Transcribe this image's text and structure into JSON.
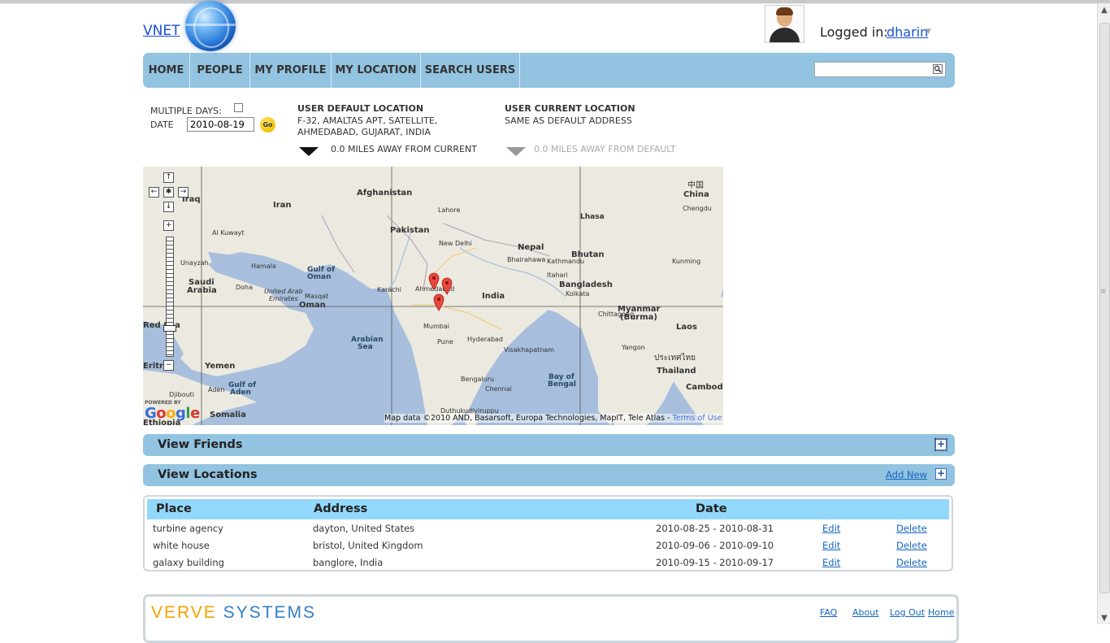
{
  "header": {
    "brand": "VNET",
    "login_label": "Logged in:",
    "username": "dharin"
  },
  "nav": {
    "items": [
      "HOME",
      "PEOPLE",
      "MY PROFILE",
      "MY LOCATION",
      "SEARCH USERS"
    ],
    "search_value": ""
  },
  "filters": {
    "multiple_days_label": "MULTIPLE DAYS:",
    "date_label": "DATE",
    "date_value": "2010-08-19",
    "go_label": "Go",
    "default_location_title": "USER DEFAULT LOCATION",
    "default_location_line1": "F-32, AMALTAS APT, SATELLITE,",
    "default_location_line2": "AHMEDABAD, GUJARAT, INDIA",
    "current_location_title": "USER CURRENT LOCATION",
    "current_location_text": "SAME AS DEFAULT ADDRESS",
    "distance_from_current": "0.0 MILES AWAY FROM CURRENT",
    "distance_from_default": "0.0 MILES AWAY FROM DEFAULT"
  },
  "map": {
    "labels": {
      "iran": "Iran",
      "afghanistan": "Afghanistan",
      "pakistan": "Pakistan",
      "china_cn": "中国",
      "china": "China",
      "india": "India",
      "nepal": "Nepal",
      "bhutan": "Bhutan",
      "bangladesh": "Bangladesh",
      "myanmar": "Myanmar",
      "burma": "(Burma)",
      "laos": "Laos",
      "thailand": "Thailand",
      "thailand_th": "ประเทศไทย",
      "cambodia": "Cambodia",
      "yemen": "Yemen",
      "oman": "Oman",
      "saudi_arabia_1": "Saudi",
      "saudi_arabia_2": "Arabia",
      "uae_1": "United Arab",
      "uae_2": "Emirates",
      "somalia": "Somalia",
      "djibouti": "Djibouti",
      "ethiopia": "Ethiopia",
      "arabian_sea_1": "Arabian",
      "arabian_sea_2": "Sea",
      "bay_bengal_1": "Bay of",
      "bay_bengal_2": "Bengal",
      "gulf_oman_1": "Gulf of",
      "gulf_oman_2": "Oman",
      "gulf_aden_1": "Gulf of",
      "gulf_aden_2": "Aden",
      "new_delhi": "New Delhi",
      "lahore": "Lahore",
      "karachi": "Karachi",
      "mumbai": "Mumbai",
      "pune": "Pune",
      "hyderabad": "Hyderabad",
      "bengaluru": "Bengaluru",
      "chennai": "Chennai",
      "kolkata": "Kolkata",
      "chittagong": "Chittagong",
      "kathmandu": "Kathmandu",
      "lhasa": "Lhasa",
      "chengdu": "Chengdu",
      "kunming": "Kunming",
      "yangon": "Yangon",
      "visakhapatnam": "Visakhapatnam",
      "muscat": "Masqat",
      "doha": "Doha",
      "ahmedabad": "Ahmedabad",
      "kuwait": "Al Kuwayt",
      "iraq": "Iraq",
      "unayzah": "Unayzah",
      "aden": "Aden",
      "bhairahawa": "Bhairahawa",
      "itahari": "Itahari",
      "hamala": "Hamala",
      "duthukudiyiruppu": "Duthukudiyiruppu",
      "red_sea": "Red Sea",
      "eritrea": "Eritrea"
    },
    "powered_by": "POWERED BY",
    "google": "Google",
    "attribution": "Map data ©2010 AND, Basarsoft, Europa Technologies, MapIT, Tele Atlas -",
    "terms": "Terms of Use"
  },
  "sections": {
    "friends_title": "View Friends",
    "locations_title": "View Locations",
    "add_new": "Add New"
  },
  "locations_table": {
    "headers": [
      "Place",
      "Address",
      "Date"
    ],
    "rows": [
      {
        "place": "turbine agency",
        "address": "dayton, United States",
        "date": "2010-08-25 - 2010-08-31",
        "edit": "Edit",
        "delete": "Delete"
      },
      {
        "place": "white house",
        "address": "bristol, United Kingdom",
        "date": "2010-09-06 - 2010-09-10",
        "edit": "Edit",
        "delete": "Delete"
      },
      {
        "place": "galaxy building",
        "address": "banglore, India",
        "date": "2010-09-15 - 2010-09-17",
        "edit": "Edit",
        "delete": "Delete"
      }
    ]
  },
  "footer": {
    "logo_part1": "VERVE",
    "logo_part2": "SYSTEMS",
    "links": [
      "FAQ",
      "About",
      "Log Out",
      "Home"
    ]
  },
  "colors": {
    "nav_bg": "#92c3e0",
    "table_header_bg": "#92d8fb",
    "link": "#1565c0"
  }
}
